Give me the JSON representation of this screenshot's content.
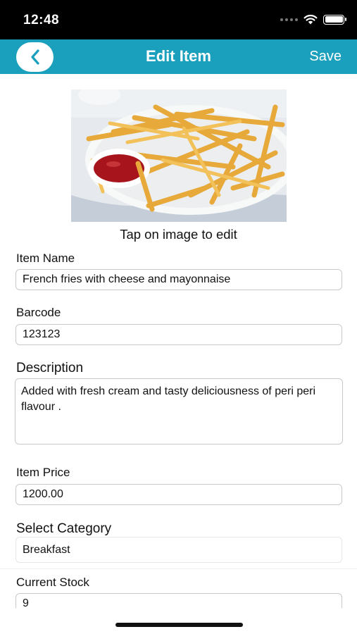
{
  "status_bar": {
    "time": "12:48"
  },
  "nav": {
    "back_icon": "chevron-left-icon",
    "title": "Edit Item",
    "save_label": "Save"
  },
  "image": {
    "hint": "Tap on image to edit"
  },
  "form": {
    "item_name": {
      "label": "Item Name",
      "value": "French fries with cheese and mayonnaise"
    },
    "barcode": {
      "label": "Barcode",
      "value": "123123"
    },
    "description": {
      "label": "Description",
      "value": "Added with fresh cream and tasty deliciousness of peri peri flavour ."
    },
    "item_price": {
      "label": "Item Price",
      "value": "1200.00"
    },
    "category": {
      "label": "Select Category",
      "value": "Breakfast"
    },
    "current_stock": {
      "label": "Current Stock",
      "value": "9"
    }
  },
  "colors": {
    "accent": "#1a9fbd",
    "status_bar": "#000000"
  }
}
